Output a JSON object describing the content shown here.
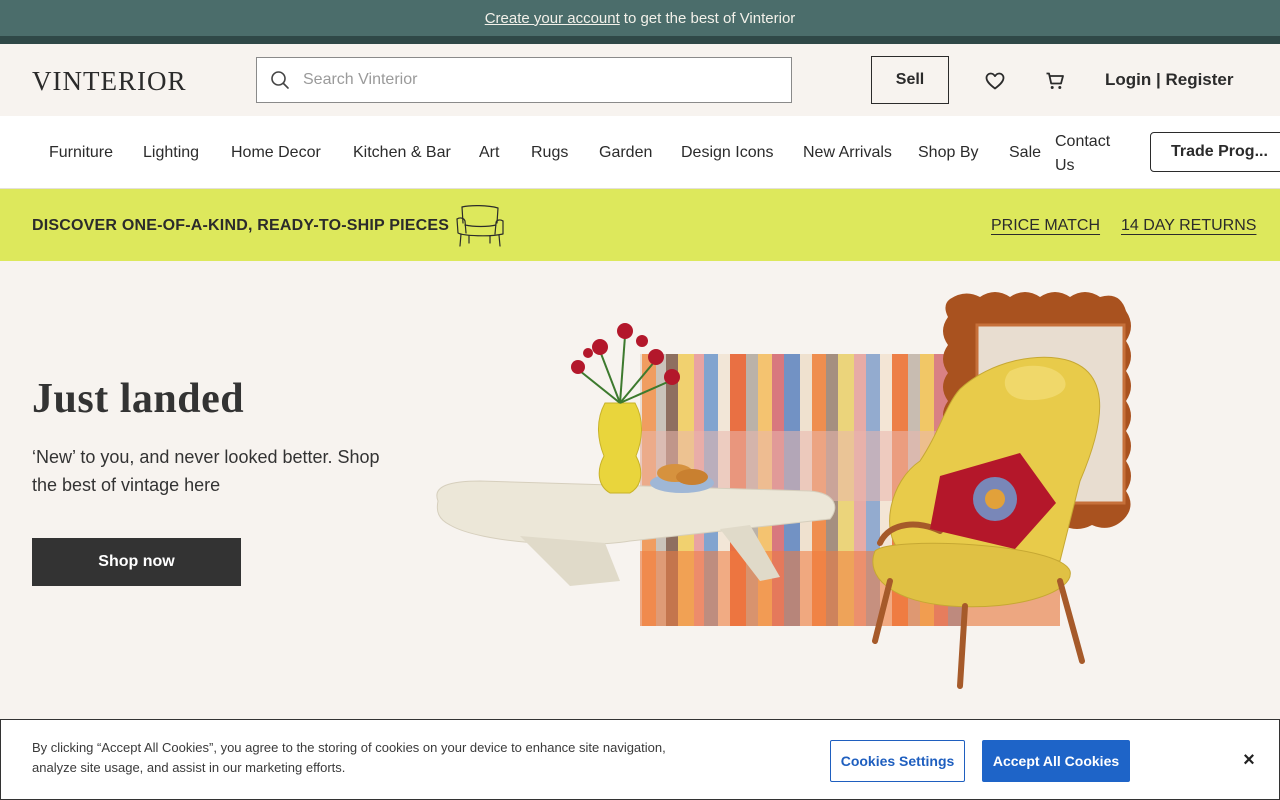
{
  "promo": {
    "link_text": "Create your account",
    "rest_text": "to get the best of Vinterior"
  },
  "header": {
    "logo": "VINTERIOR",
    "search_placeholder": "Search Vinterior",
    "search_icon": "search-icon",
    "sell_label": "Sell",
    "wishlist_icon": "heart-icon",
    "cart_icon": "cart-icon",
    "login_label": "Login | Register"
  },
  "nav": {
    "items": [
      "Furniture",
      "Lighting",
      "Home Decor",
      "Kitchen & Bar",
      "Art",
      "Rugs",
      "Garden",
      "Design Icons",
      "New Arrivals",
      "Shop By",
      "Sale"
    ],
    "contact": "Contact Us",
    "trade": "Trade Prog..."
  },
  "discover": {
    "text": "DISCOVER ONE-OF-A-KIND, READY-TO-SHIP PIECES",
    "icon": "armchair-sketch-icon",
    "links": [
      "PRICE MATCH",
      "14 DAY RETURNS"
    ]
  },
  "hero": {
    "title": "Just landed",
    "subtitle": "‘New’ to you, and never looked better. Shop the best of vintage here",
    "cta": "Shop now"
  },
  "cookie": {
    "text": "By clicking “Accept All Cookies”, you agree to the storing of cookies on your device to enhance site navigation, analyze site usage, and assist in our marketing efforts.",
    "settings_label": "Cookies Settings",
    "accept_label": "Accept All Cookies",
    "close_label": "×"
  },
  "colors": {
    "promo_bg": "#4b6d6b",
    "discover_bg": "#dde85c",
    "hero_bg": "#f7f3ef",
    "accent_blue": "#1e64c8"
  }
}
